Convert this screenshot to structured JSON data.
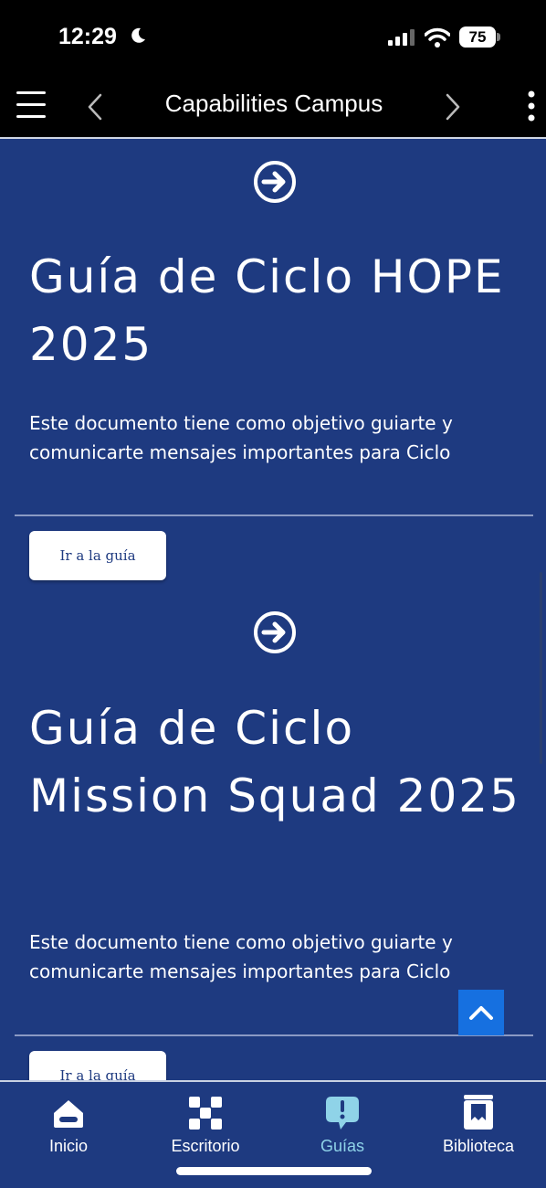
{
  "status_bar": {
    "time": "12:29",
    "battery": "75"
  },
  "header": {
    "title": "Capabilities Campus"
  },
  "guides": [
    {
      "title": "Guía de Ciclo HOPE 2025",
      "description": "Este documento tiene como objetivo guiarte y comunicarte mensajes importantes para Ciclo",
      "button_label": "Ir a la guía"
    },
    {
      "title": "Guía de Ciclo Mission Squad 2025",
      "description": "Este documento tiene como objetivo guiarte y comunicarte mensajes importantes para Ciclo",
      "button_label": "Ir a la guía"
    }
  ],
  "bottom_nav": {
    "items": [
      {
        "label": "Inicio",
        "icon": "home-icon"
      },
      {
        "label": "Escritorio",
        "icon": "desktop-grid-icon"
      },
      {
        "label": "Guías",
        "icon": "guide-alert-icon",
        "active": true
      },
      {
        "label": "Biblioteca",
        "icon": "library-book-icon"
      }
    ]
  },
  "colors": {
    "background": "#1e3a80",
    "accent": "#1670e0",
    "active_tab": "#8fd3e8"
  }
}
